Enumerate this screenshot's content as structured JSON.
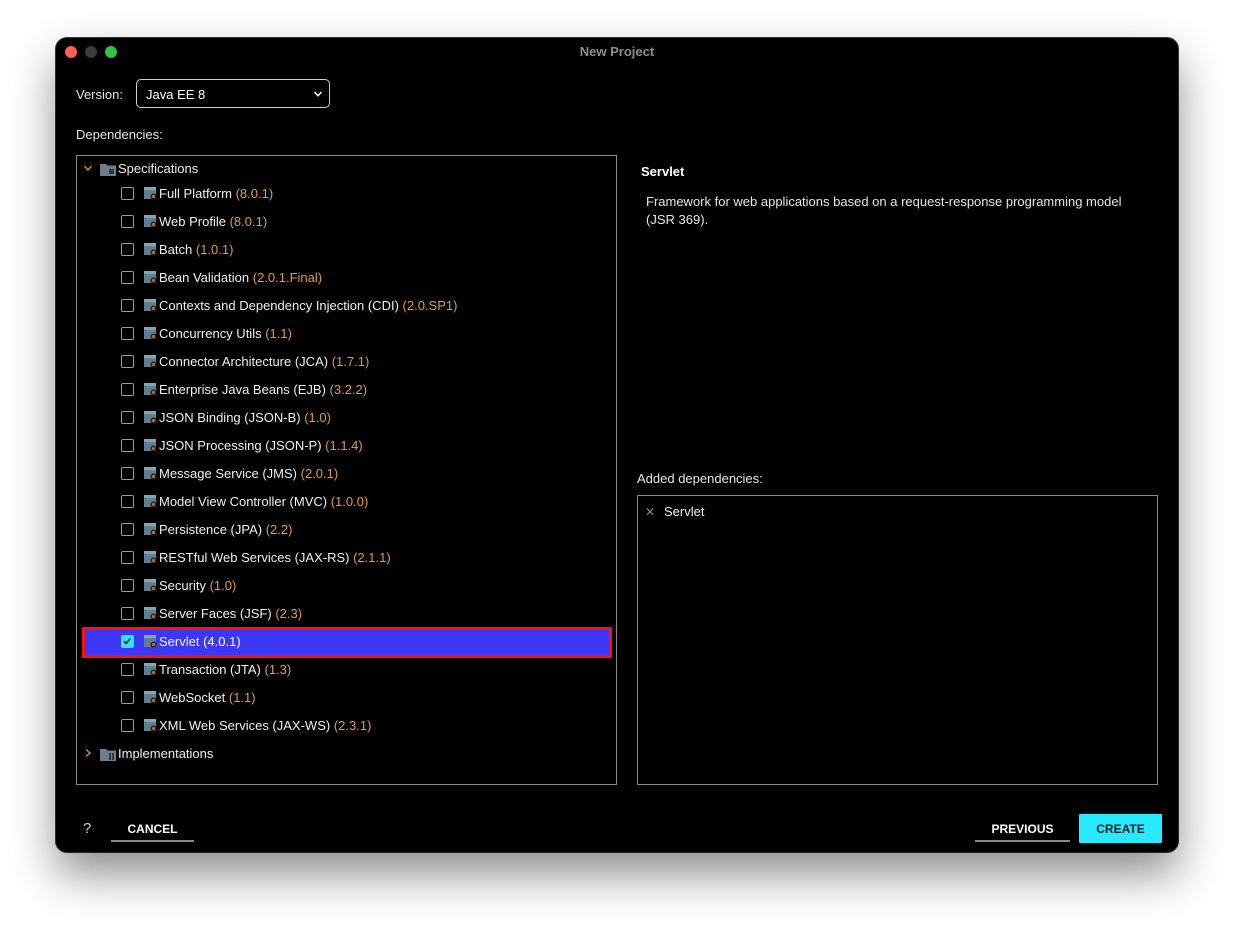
{
  "window": {
    "title": "New Project"
  },
  "version": {
    "label": "Version:",
    "value": "Java EE 8"
  },
  "dependencies_label": "Dependencies:",
  "tree": {
    "specifications_label": "Specifications",
    "implementations_label": "Implementations",
    "items": [
      {
        "name": "Full Platform",
        "version": "(8.0.1)",
        "checked": false
      },
      {
        "name": "Web Profile",
        "version": "(8.0.1)",
        "checked": false
      },
      {
        "name": "Batch",
        "version": "(1.0.1)",
        "checked": false
      },
      {
        "name": "Bean Validation",
        "version": "(2.0.1.Final)",
        "checked": false
      },
      {
        "name": "Contexts and Dependency Injection (CDI)",
        "version": "(2.0.SP1)",
        "checked": false
      },
      {
        "name": "Concurrency Utils",
        "version": "(1.1)",
        "checked": false
      },
      {
        "name": "Connector Architecture (JCA)",
        "version": "(1.7.1)",
        "checked": false
      },
      {
        "name": "Enterprise Java Beans (EJB)",
        "version": "(3.2.2)",
        "checked": false
      },
      {
        "name": "JSON Binding (JSON-B)",
        "version": "(1.0)",
        "checked": false
      },
      {
        "name": "JSON Processing (JSON-P)",
        "version": "(1.1.4)",
        "checked": false
      },
      {
        "name": "Message Service (JMS)",
        "version": "(2.0.1)",
        "checked": false
      },
      {
        "name": "Model View Controller (MVC)",
        "version": "(1.0.0)",
        "checked": false
      },
      {
        "name": "Persistence (JPA)",
        "version": "(2.2)",
        "checked": false
      },
      {
        "name": "RESTful Web Services (JAX-RS)",
        "version": "(2.1.1)",
        "checked": false
      },
      {
        "name": "Security",
        "version": "(1.0)",
        "checked": false
      },
      {
        "name": "Server Faces (JSF)",
        "version": "(2.3)",
        "checked": false
      },
      {
        "name": "Servlet",
        "version": "(4.0.1)",
        "checked": true
      },
      {
        "name": "Transaction (JTA)",
        "version": "(1.3)",
        "checked": false
      },
      {
        "name": "WebSocket",
        "version": "(1.1)",
        "checked": false
      },
      {
        "name": "XML Web Services (JAX-WS)",
        "version": "(2.3.1)",
        "checked": false
      }
    ]
  },
  "description": {
    "title": "Servlet",
    "text": "Framework for web applications based on a request-response programming model (JSR 369)."
  },
  "added": {
    "label": "Added dependencies:",
    "items": [
      "Servlet"
    ]
  },
  "footer": {
    "help": "?",
    "cancel": "CANCEL",
    "previous": "PREVIOUS",
    "create": "CREATE"
  },
  "colors": {
    "accent": "#28eaff",
    "selection": "#3c36f5",
    "highlight_border": "#ff1010",
    "version_text": "#e59a47"
  }
}
